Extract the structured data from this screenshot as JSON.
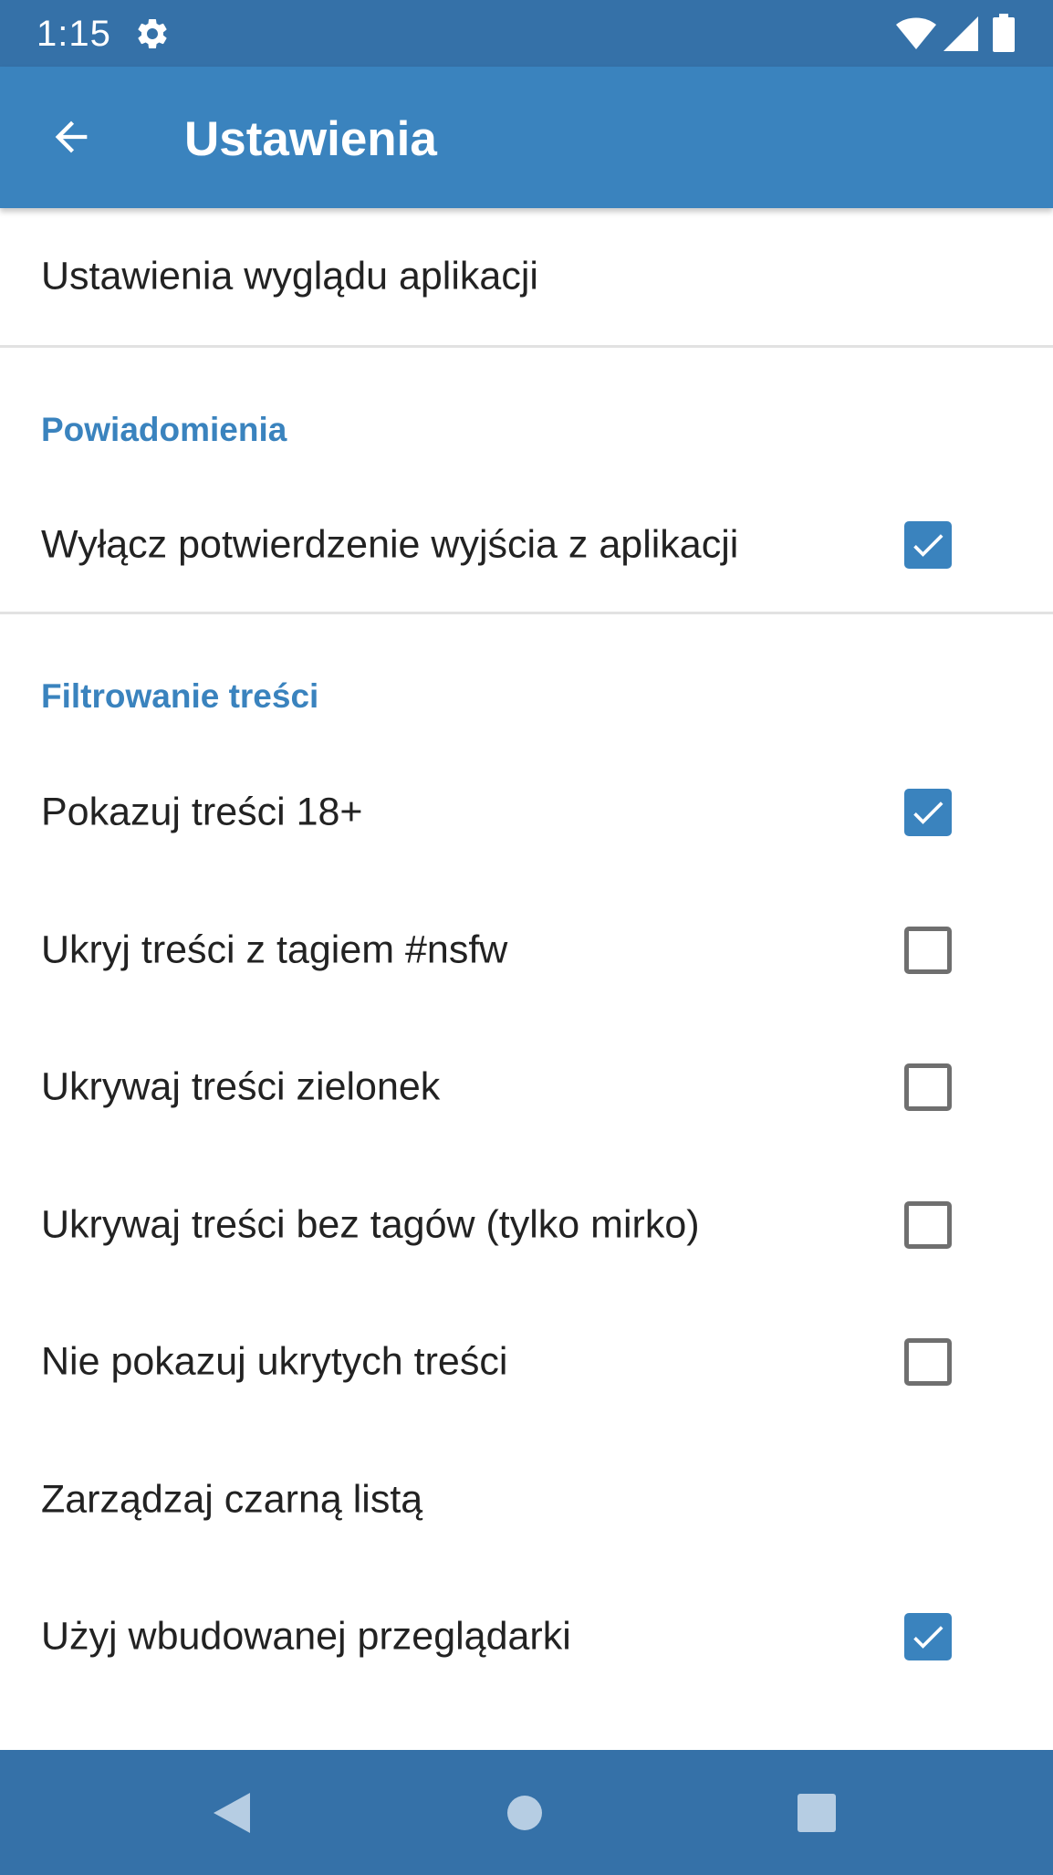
{
  "status_bar": {
    "time": "1:15",
    "icons": [
      "gear-icon",
      "wifi-icon",
      "signal-icon",
      "battery-icon"
    ]
  },
  "app_bar": {
    "title": "Ustawienia",
    "back_icon": "arrow-back-icon"
  },
  "settings": {
    "appearance": {
      "label": "Ustawienia wyglądu aplikacji"
    },
    "notifications": {
      "header": "Powiadomienia",
      "items": [
        {
          "label": "Wyłącz potwierdzenie wyjścia z aplikacji",
          "checked": true
        }
      ]
    },
    "filtering": {
      "header": "Filtrowanie treści",
      "items": [
        {
          "label": "Pokazuj treści 18+",
          "checked": true
        },
        {
          "label": "Ukryj treści z tagiem #nsfw",
          "checked": false
        },
        {
          "label": "Ukrywaj treści zielonek",
          "checked": false
        },
        {
          "label": "Ukrywaj treści bez tagów (tylko mirko)",
          "checked": false
        },
        {
          "label": "Nie pokazuj ukrytych treści",
          "checked": false
        },
        {
          "label": "Zarządzaj czarną listą",
          "checked": null
        },
        {
          "label": "Użyj wbudowanej przeglądarki",
          "checked": true
        }
      ]
    }
  },
  "nav_bar": {
    "buttons": [
      "back-triangle-icon",
      "home-circle-icon",
      "recents-square-icon"
    ]
  },
  "colors": {
    "status_bar": "#3571a8",
    "app_bar": "#3a83be",
    "accent": "#3a83be",
    "text": "#222222",
    "nav_bar": "#3571a8"
  }
}
